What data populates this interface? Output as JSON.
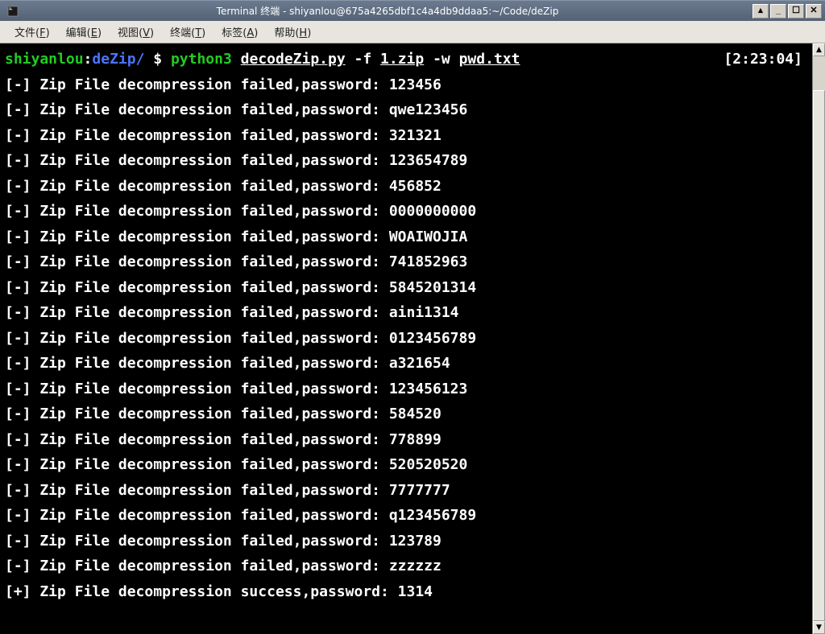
{
  "window": {
    "title": "Terminal 终端 - shiyanlou@675a4265dbf1c4a4db9ddaa5:~/Code/deZip"
  },
  "menu": {
    "file": {
      "label": "文件",
      "accel": "F"
    },
    "edit": {
      "label": "编辑",
      "accel": "E"
    },
    "view": {
      "label": "视图",
      "accel": "V"
    },
    "term": {
      "label": "终端",
      "accel": "T"
    },
    "tabs": {
      "label": "标签",
      "accel": "A"
    },
    "help": {
      "label": "帮助",
      "accel": "H"
    }
  },
  "prompt": {
    "user": "shiyanlou",
    "sep": ":",
    "cwd": "deZip/",
    "dollar": " $ ",
    "cmd_bin": "python3",
    "cmd_sp1": " ",
    "cmd_script": "decodeZip.py",
    "cmd_arg_f": " -f ",
    "cmd_file": "1.zip",
    "cmd_arg_w": " -w ",
    "cmd_wlist": "pwd.txt",
    "clock": "[2:23:04]"
  },
  "output_prefix_fail": "[-] Zip File decompression failed,password: ",
  "output_prefix_ok": "[+] Zip File decompression success,password: ",
  "passwords_failed": [
    "123456",
    "qwe123456",
    "321321",
    "123654789",
    "456852",
    "0000000000",
    "WOAIWOJIA",
    "741852963",
    "5845201314",
    "aini1314",
    "0123456789",
    "a321654",
    "123456123",
    "584520",
    "778899",
    "520520520",
    "7777777",
    "q123456789",
    "123789",
    "zzzzzz"
  ],
  "password_success": "1314",
  "window_controls": {
    "shade": "▴",
    "min": "_",
    "max": "☐",
    "close": "✕"
  },
  "scroll": {
    "up": "▲",
    "down": "▼"
  }
}
